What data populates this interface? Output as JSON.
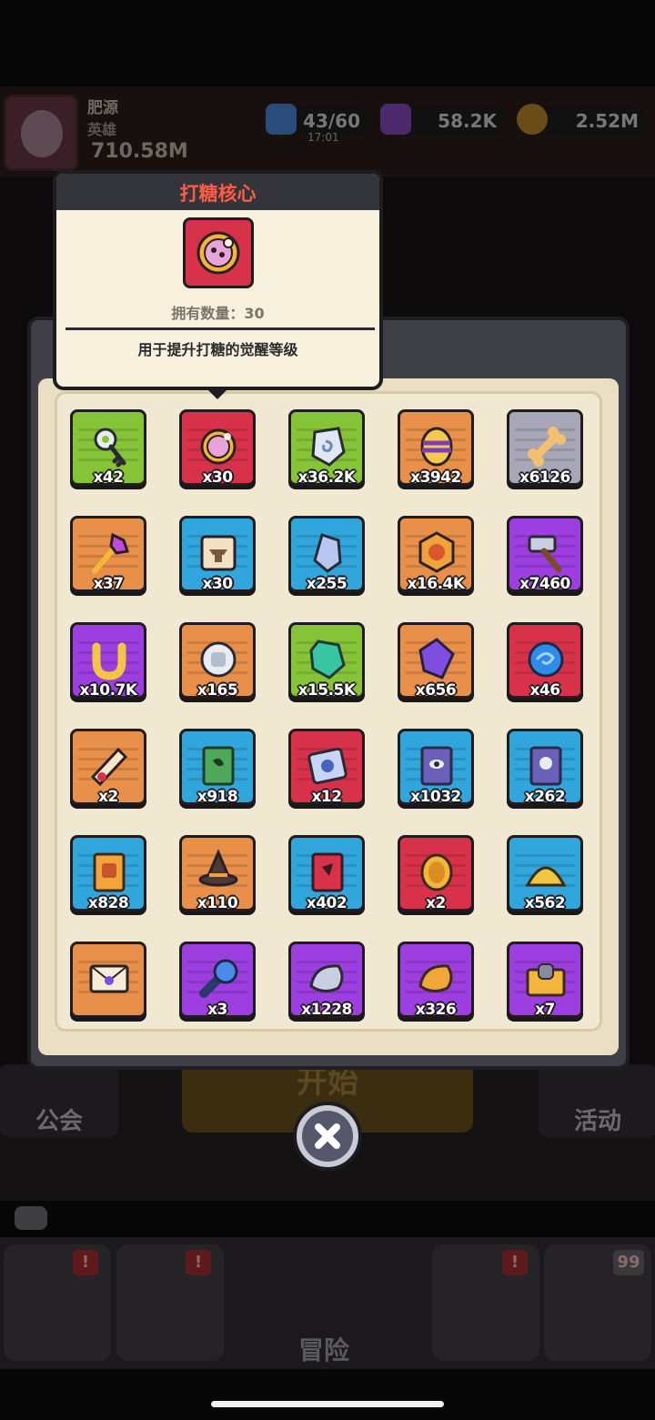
{
  "header": {
    "player_name": "肥源",
    "player_title": "英雄",
    "power": "710.58M",
    "energy": "43/60",
    "energy_timer": "17:01",
    "gems": "58.2K",
    "coins": "2.52M"
  },
  "background": {
    "guild_label": "公会",
    "start_label": "开始",
    "events_label": "活动",
    "adventure_label": "冒险",
    "nav_badges": [
      "!",
      "!",
      "!",
      "99"
    ]
  },
  "tooltip": {
    "title": "打糖核心",
    "count_text": "拥有数量：30",
    "description": "用于提升打糖的觉醒等级"
  },
  "inventory": {
    "items": [
      {
        "name": "silver-key",
        "bg": "green",
        "qty": "x42",
        "icon": "key-icon"
      },
      {
        "name": "candy-core",
        "bg": "red",
        "qty": "x30",
        "icon": "core-icon"
      },
      {
        "name": "rune-stone",
        "bg": "green",
        "qty": "x36.2K",
        "icon": "rune-stone-icon"
      },
      {
        "name": "striped-egg",
        "bg": "orange",
        "qty": "x3942",
        "icon": "egg-icon"
      },
      {
        "name": "bone",
        "bg": "gray",
        "qty": "x6126",
        "icon": "bone-icon"
      },
      {
        "name": "flower-wand",
        "bg": "orange",
        "qty": "x37",
        "icon": "wand-icon"
      },
      {
        "name": "anvil-scroll",
        "bg": "blue",
        "qty": "x30",
        "icon": "scroll-icon"
      },
      {
        "name": "blue-crystal",
        "bg": "blue",
        "qty": "x255",
        "icon": "crystal-icon"
      },
      {
        "name": "hex-medal",
        "bg": "orange",
        "qty": "x16.4K",
        "icon": "medal-icon"
      },
      {
        "name": "hammer",
        "bg": "purple",
        "qty": "x7460",
        "icon": "hammer-icon"
      },
      {
        "name": "horseshoe",
        "bg": "purple",
        "qty": "x10.7K",
        "icon": "horseshoe-icon"
      },
      {
        "name": "silver-coin",
        "bg": "orange",
        "qty": "x165",
        "icon": "coin-icon"
      },
      {
        "name": "green-ore",
        "bg": "green",
        "qty": "x15.5K",
        "icon": "ore-icon"
      },
      {
        "name": "purple-gem",
        "bg": "orange",
        "qty": "x656",
        "icon": "gem-icon"
      },
      {
        "name": "blue-orb",
        "bg": "red",
        "qty": "x46",
        "icon": "orb-icon"
      },
      {
        "name": "parchment",
        "bg": "orange",
        "qty": "x2",
        "icon": "parchment-icon"
      },
      {
        "name": "leaf-book",
        "bg": "blue",
        "qty": "x918",
        "icon": "book-icon"
      },
      {
        "name": "moon-ticket",
        "bg": "red",
        "qty": "x12",
        "icon": "ticket-icon"
      },
      {
        "name": "eye-tome",
        "bg": "blue",
        "qty": "x1032",
        "icon": "tome-icon"
      },
      {
        "name": "skull-tome",
        "bg": "blue",
        "qty": "x262",
        "icon": "skull-book-icon"
      },
      {
        "name": "gold-book",
        "bg": "blue",
        "qty": "x828",
        "icon": "gold-book-icon"
      },
      {
        "name": "witch-hat",
        "bg": "orange",
        "qty": "x110",
        "icon": "hat-icon"
      },
      {
        "name": "red-book",
        "bg": "blue",
        "qty": "x402",
        "icon": "red-book-icon"
      },
      {
        "name": "gold-coin",
        "bg": "red",
        "qty": "x2",
        "icon": "gold-coin-icon"
      },
      {
        "name": "gold-pile",
        "bg": "blue",
        "qty": "x562",
        "icon": "gold-pile-icon"
      },
      {
        "name": "envelope",
        "bg": "orange",
        "qty": "",
        "icon": "envelope-icon"
      },
      {
        "name": "flashlight",
        "bg": "purple",
        "qty": "x3",
        "icon": "flashlight-icon"
      },
      {
        "name": "silver-shell",
        "bg": "purple",
        "qty": "x1228",
        "icon": "shell-icon"
      },
      {
        "name": "gold-shell",
        "bg": "purple",
        "qty": "x326",
        "icon": "gold-shell-icon"
      },
      {
        "name": "treasure-chest",
        "bg": "purple",
        "qty": "x7",
        "icon": "chest-icon"
      }
    ]
  },
  "colors": {
    "green": "#86c437",
    "red": "#d8324a",
    "orange": "#e8904a",
    "gray": "#a7a7b8",
    "blue": "#30a6dd",
    "purple": "#9d3ee0"
  }
}
